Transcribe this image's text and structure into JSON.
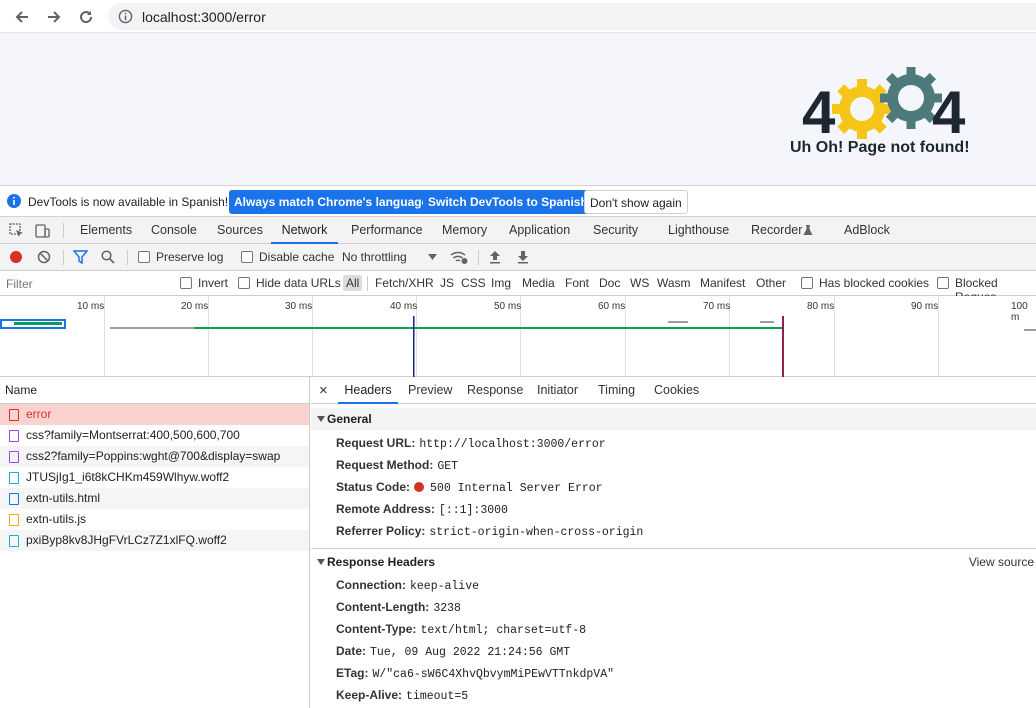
{
  "browser": {
    "url": "localhost:3000/error"
  },
  "page": {
    "logo_digits": [
      "4",
      "4"
    ],
    "message": "Uh Oh! Page not found!"
  },
  "infobar": {
    "text": "DevTools is now available in Spanish!",
    "match_button": "Always match Chrome's language",
    "switch_button": "Switch DevTools to Spanish",
    "dismiss_button": "Don't show again"
  },
  "devtools_tabs": [
    "Elements",
    "Console",
    "Sources",
    "Network",
    "Performance",
    "Memory",
    "Application",
    "Security",
    "Lighthouse",
    "Recorder",
    "AdBlock"
  ],
  "active_tab": "Network",
  "network_toolbar": {
    "preserve_log": "Preserve log",
    "disable_cache": "Disable cache",
    "throttling": "No throttling"
  },
  "filter_bar": {
    "placeholder": "Filter",
    "invert": "Invert",
    "hide_data_urls": "Hide data URLs",
    "types": [
      "All",
      "Fetch/XHR",
      "JS",
      "CSS",
      "Img",
      "Media",
      "Font",
      "Doc",
      "WS",
      "Wasm",
      "Manifest",
      "Other"
    ],
    "has_blocked_cookies": "Has blocked cookies",
    "blocked_requests": "Blocked Reques"
  },
  "timeline": {
    "ticks": [
      "10 ms",
      "20 ms",
      "30 ms",
      "40 ms",
      "50 ms",
      "60 ms",
      "70 ms",
      "80 ms",
      "90 ms",
      "100 m"
    ]
  },
  "request_list": {
    "header": "Name",
    "rows": [
      {
        "name": "error",
        "type": "doc"
      },
      {
        "name": "css?family=Montserrat:400,500,600,700",
        "type": "css"
      },
      {
        "name": "css2?family=Poppins:wght@700&display=swap",
        "type": "css"
      },
      {
        "name": "JTUSjIg1_i6t8kCHKm459Wlhyw.woff2",
        "type": "font"
      },
      {
        "name": "extn-utils.html",
        "type": "doc"
      },
      {
        "name": "extn-utils.js",
        "type": "js"
      },
      {
        "name": "pxiByp8kv8JHgFVrLCz7Z1xlFQ.woff2",
        "type": "font"
      }
    ]
  },
  "details": {
    "close": "×",
    "tabs": [
      "Headers",
      "Preview",
      "Response",
      "Initiator",
      "Timing",
      "Cookies"
    ],
    "general_title": "General",
    "general": [
      {
        "key": "Request URL:",
        "value": "http://localhost:3000/error"
      },
      {
        "key": "Request Method:",
        "value": "GET"
      },
      {
        "key": "Status Code:",
        "value": "500 Internal Server Error"
      },
      {
        "key": "Remote Address:",
        "value": "[::1]:3000"
      },
      {
        "key": "Referrer Policy:",
        "value": "strict-origin-when-cross-origin"
      }
    ],
    "response_title": "Response Headers",
    "view_source": "View source",
    "response": [
      {
        "key": "Connection:",
        "value": "keep-alive"
      },
      {
        "key": "Content-Length:",
        "value": "3238"
      },
      {
        "key": "Content-Type:",
        "value": "text/html; charset=utf-8"
      },
      {
        "key": "Date:",
        "value": "Tue, 09 Aug 2022 21:24:56 GMT"
      },
      {
        "key": "ETag:",
        "value": "W/\"ca6-sW6C4XhvQbvymMiPEwVTTnkdpVA\""
      },
      {
        "key": "Keep-Alive:",
        "value": "timeout=5"
      }
    ]
  },
  "colors": {
    "accent": "#1a73e8",
    "error": "#d93025",
    "gear_yellow": "#f5c518",
    "gear_teal": "#4f7a7c",
    "logo_dark": "#1d2731"
  }
}
